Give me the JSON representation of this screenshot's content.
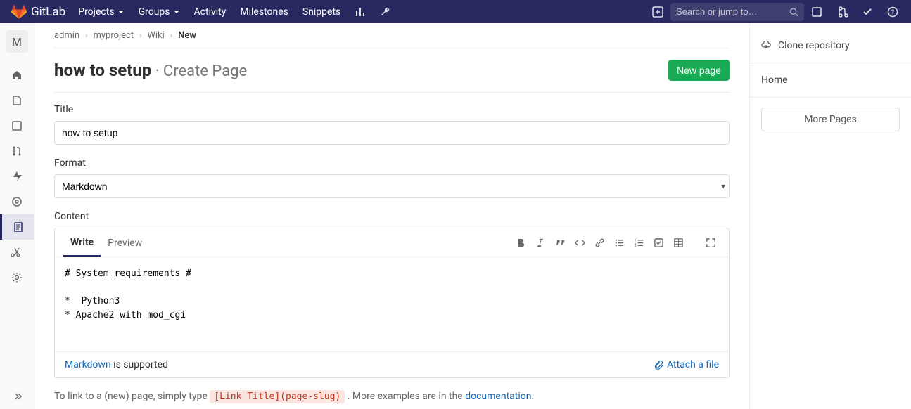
{
  "topnav": {
    "brand": "GitLab",
    "items": [
      "Projects",
      "Groups",
      "Activity",
      "Milestones",
      "Snippets"
    ],
    "search_placeholder": "Search or jump to…"
  },
  "project_letter": "M",
  "breadcrumb": {
    "a": "admin",
    "b": "myproject",
    "c": "Wiki",
    "current": "New"
  },
  "heading": {
    "title": "how to setup",
    "sub": " · Create Page"
  },
  "new_page_btn": "New page",
  "form": {
    "title_label": "Title",
    "title_value": "how to setup",
    "format_label": "Format",
    "format_value": "Markdown",
    "content_label": "Content"
  },
  "editor": {
    "write_tab": "Write",
    "preview_tab": "Preview",
    "content": "# System requirements #\n\n*  Python3\n* Apache2 with mod_cgi",
    "markdown_link": "Markdown",
    "supported_text": " is supported",
    "attach": "Attach a file"
  },
  "help": {
    "prefix": "To link to a (new) page, simply type ",
    "code": "[Link Title](page-slug)",
    "middle": " . More examples are in the ",
    "doclink": "documentation",
    "suffix": "."
  },
  "right": {
    "clone": "Clone repository",
    "home": "Home",
    "more": "More Pages"
  }
}
